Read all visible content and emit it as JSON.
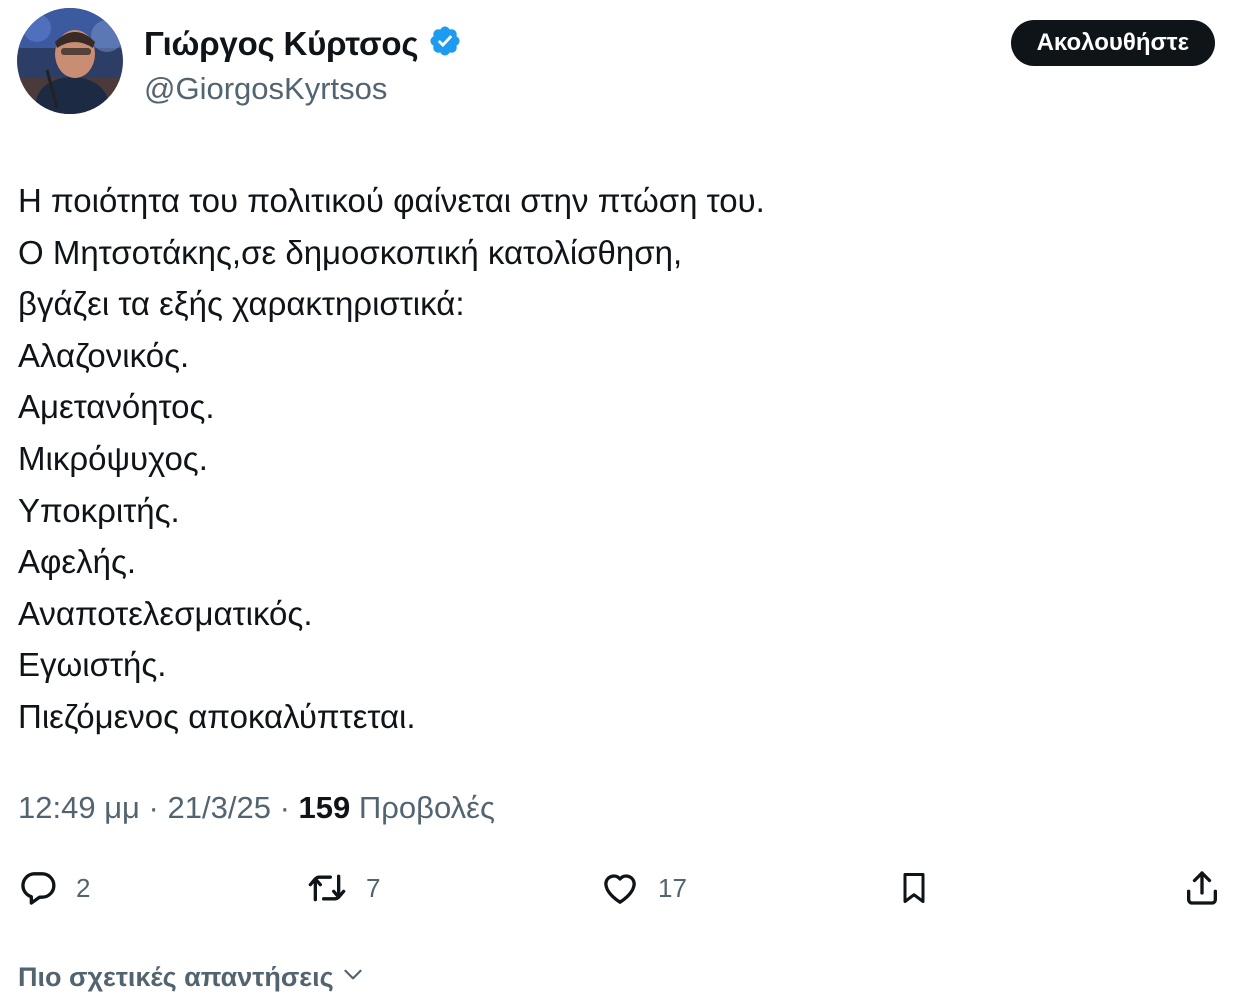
{
  "user": {
    "display_name": "Γιώργος Κύρτσος",
    "handle": "@GiorgosKyrtsos",
    "verified_color": "#1d9bf0"
  },
  "follow_button": {
    "label": "Ακολουθήστε"
  },
  "tweet": {
    "lines": [
      "Η ποιότητα του πολιτικού φαίνεται στην πτώση του.",
      "Ο Μητσοτάκης,σε δημοσκοπική κατολίσθηση,",
      "βγάζει τα εξής χαρακτηριστικά:",
      "Αλαζονικός.",
      "Αμετανόητος.",
      "Μικρόψυχος.",
      "Υποκριτής.",
      "Αφελής.",
      "Αναποτελεσματικός.",
      "Εγωιστής.",
      "Πιεζόμενος αποκαλύπτεται."
    ]
  },
  "meta": {
    "time": "12:49 μμ",
    "separator": "·",
    "date": "21/3/25",
    "views_count": "159",
    "views_label": "Προβολές"
  },
  "actions": {
    "replies": "2",
    "retweets": "7",
    "likes": "17"
  },
  "related_replies": {
    "label": "Πιο σχετικές απαντήσεις"
  },
  "icons": {
    "reply": "reply-icon",
    "retweet": "retweet-icon",
    "like": "heart-icon",
    "bookmark": "bookmark-icon",
    "share": "share-icon",
    "chevron": "chevron-down-icon",
    "verified": "verified-badge-icon"
  },
  "colors": {
    "text": "#0f1419",
    "secondary": "#536471",
    "follow_bg": "#0f1419"
  }
}
